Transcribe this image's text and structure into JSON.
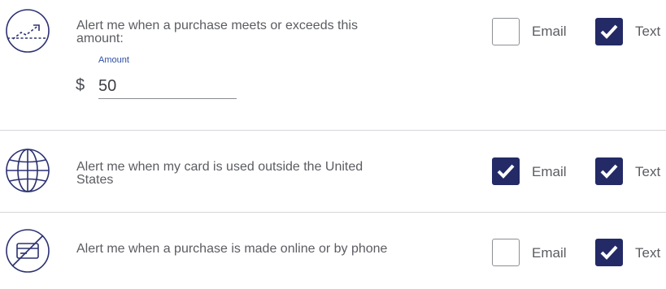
{
  "alerts": [
    {
      "icon": "trending-up-icon",
      "text": "Alert me when a purchase meets or exceeds this amount:",
      "amount_label": "Amount",
      "currency_symbol": "$",
      "amount_value": "50",
      "email_label": "Email",
      "email_checked": false,
      "text_label": "Text",
      "text_checked": true
    },
    {
      "icon": "globe-icon",
      "text": "Alert me when my card is used outside the United States",
      "email_label": "Email",
      "email_checked": true,
      "text_label": "Text",
      "text_checked": true
    },
    {
      "icon": "card-not-present-icon",
      "text": "Alert me when a purchase is made online or by phone",
      "email_label": "Email",
      "email_checked": false,
      "text_label": "Text",
      "text_checked": true
    }
  ],
  "colors": {
    "accent": "#232a66",
    "icon": "#2b3170",
    "label_blue": "#2e4fa3",
    "divider": "#d6d6d9"
  }
}
